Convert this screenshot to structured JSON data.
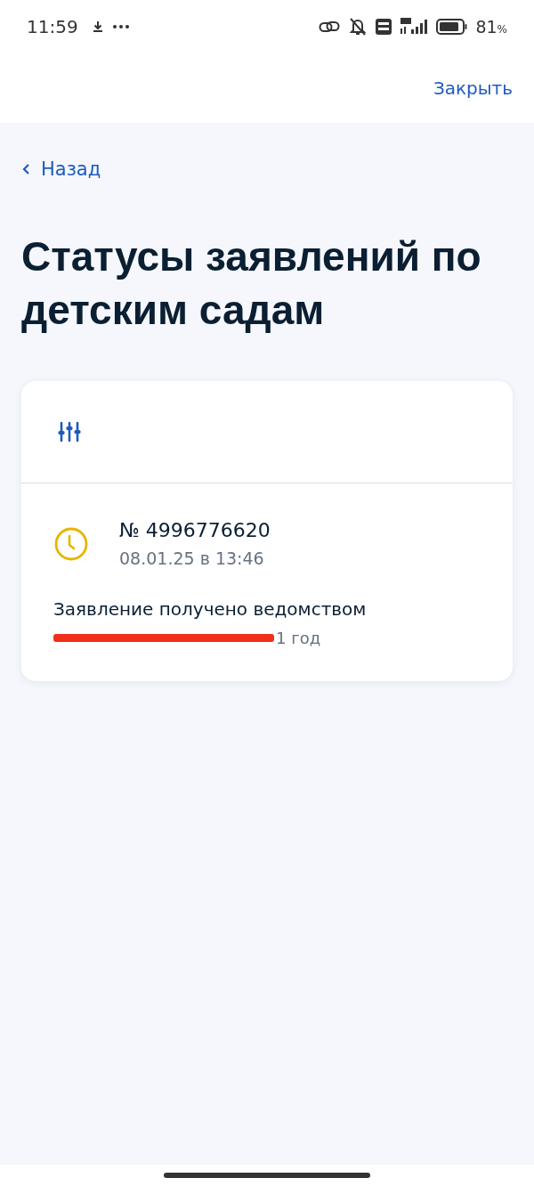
{
  "status_bar": {
    "time": "11:59",
    "battery_percent": "81",
    "percent_sign": "%"
  },
  "header": {
    "close": "Закрыть"
  },
  "back": "Назад",
  "title": "Статусы заявлений по детским садам",
  "applications": [
    {
      "color": "#e8b400",
      "number": "№ 4996776620",
      "date": "08.01.25 в 13:46",
      "status": "Заявление получено ведомством",
      "details": "1 год",
      "redacted": true
    }
  ]
}
